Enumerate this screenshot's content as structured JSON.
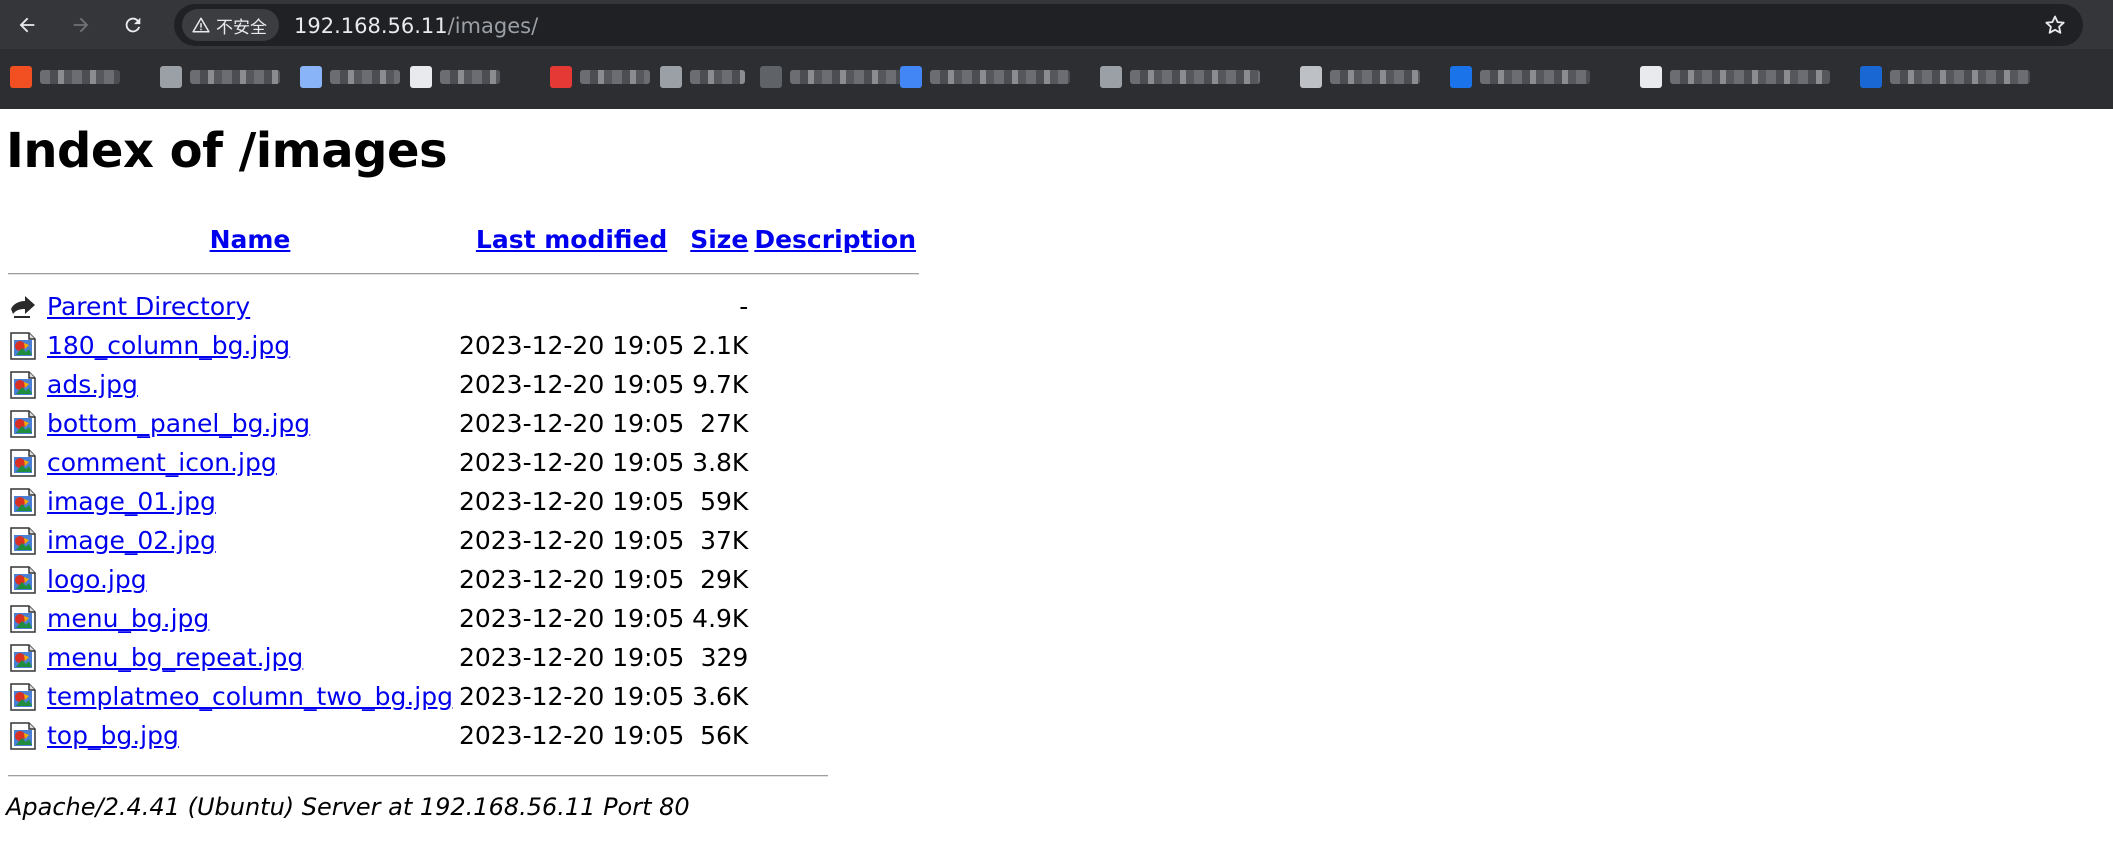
{
  "browser": {
    "security_label": "不安全",
    "url_host": "192.168.56.11",
    "url_path": "/images/",
    "bookmarks": [
      {
        "favicon_color": "#f25022"
      },
      {
        "favicon_color": "#9aa0a6"
      },
      {
        "favicon_color": "#8ab4f8"
      },
      {
        "favicon_color": "#e8eaed"
      },
      {
        "favicon_color": "#e53935"
      },
      {
        "favicon_color": "#9aa0a6"
      },
      {
        "favicon_color": "#5f6368"
      },
      {
        "favicon_color": "#4285f4"
      },
      {
        "favicon_color": "#9aa0a6"
      },
      {
        "favicon_color": "#bdc1c6"
      },
      {
        "favicon_color": "#1a73e8"
      },
      {
        "favicon_color": "#e8eaed"
      },
      {
        "favicon_color": "#1967d2"
      }
    ]
  },
  "page": {
    "title": "Index of /images",
    "columns": {
      "name": "Name",
      "last_modified": "Last modified",
      "size": "Size",
      "description": "Description"
    },
    "parent": {
      "name": "Parent Directory",
      "size": "-",
      "icon": "back-arrow-icon"
    },
    "files": [
      {
        "name": "180_column_bg.jpg",
        "modified": "2023-12-20 19:05",
        "size": "2.1K",
        "icon": "image-file-icon"
      },
      {
        "name": "ads.jpg",
        "modified": "2023-12-20 19:05",
        "size": "9.7K",
        "icon": "image-file-icon"
      },
      {
        "name": "bottom_panel_bg.jpg",
        "modified": "2023-12-20 19:05",
        "size": "27K",
        "icon": "image-file-icon"
      },
      {
        "name": "comment_icon.jpg",
        "modified": "2023-12-20 19:05",
        "size": "3.8K",
        "icon": "image-file-icon"
      },
      {
        "name": "image_01.jpg",
        "modified": "2023-12-20 19:05",
        "size": "59K",
        "icon": "image-file-icon"
      },
      {
        "name": "image_02.jpg",
        "modified": "2023-12-20 19:05",
        "size": "37K",
        "icon": "image-file-icon"
      },
      {
        "name": "logo.jpg",
        "modified": "2023-12-20 19:05",
        "size": "29K",
        "icon": "image-file-icon"
      },
      {
        "name": "menu_bg.jpg",
        "modified": "2023-12-20 19:05",
        "size": "4.9K",
        "icon": "image-file-icon"
      },
      {
        "name": "menu_bg_repeat.jpg",
        "modified": "2023-12-20 19:05",
        "size": "329",
        "icon": "image-file-icon"
      },
      {
        "name": "templatmeo_column_two_bg.jpg",
        "modified": "2023-12-20 19:05",
        "size": "3.6K",
        "icon": "image-file-icon"
      },
      {
        "name": "top_bg.jpg",
        "modified": "2023-12-20 19:05",
        "size": "56K",
        "icon": "image-file-icon"
      }
    ],
    "server_signature": "Apache/2.4.41 (Ubuntu) Server at 192.168.56.11 Port 80"
  }
}
